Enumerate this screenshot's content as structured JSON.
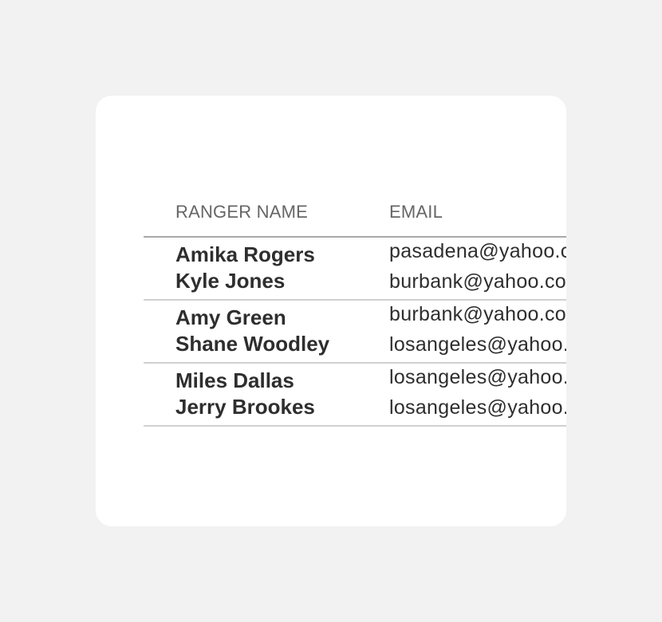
{
  "table": {
    "headers": {
      "name": "RANGER NAME",
      "email": "EMAIL"
    },
    "groups": [
      {
        "rows": [
          {
            "name": "Amika Rogers",
            "email": "pasadena@yahoo.com"
          },
          {
            "name": "Kyle Jones",
            "email": "burbank@yahoo.com"
          }
        ]
      },
      {
        "rows": [
          {
            "name": "Amy Green",
            "email": "burbank@yahoo.com"
          },
          {
            "name": "Shane Woodley",
            "email": "losangeles@yahoo.com"
          }
        ]
      },
      {
        "rows": [
          {
            "name": "Miles Dallas",
            "email": "losangeles@yahoo.com"
          },
          {
            "name": "Jerry Brookes",
            "email": "losangeles@yahoo.com"
          }
        ]
      }
    ]
  }
}
